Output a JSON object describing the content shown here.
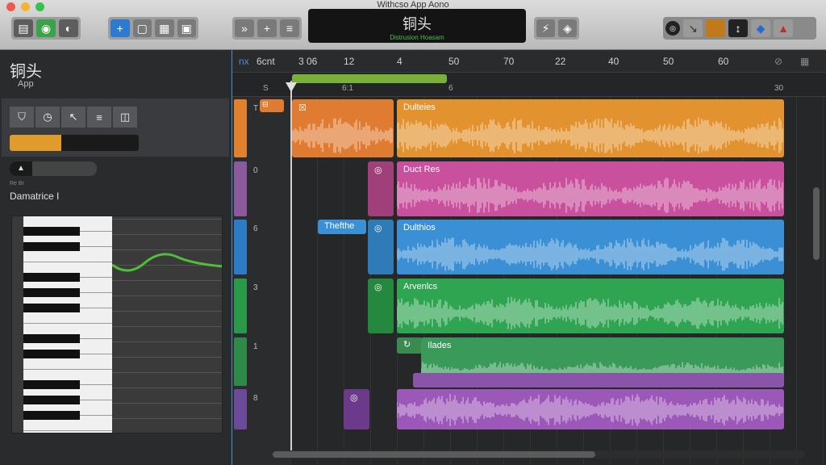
{
  "window": {
    "title": "Withcso App Aono"
  },
  "toolbar": {
    "left_icons": [
      "library-icon",
      "smart-controls-icon",
      "mixer-icon"
    ],
    "edit_icons": [
      "add-track-icon",
      "editor-icon",
      "loop-icon",
      "note-icon"
    ],
    "transport_icons": [
      "forward-icon",
      "plus-icon",
      "list-icon"
    ],
    "right_icons": [
      "tuner-icon",
      "metronome-icon"
    ],
    "lcd_title": "铜头",
    "lcd_sub": "Distrusion Hoasam"
  },
  "inspector": {
    "title": "铜头",
    "subtitle": "App",
    "tool_icons": [
      "shield-icon",
      "timer-icon",
      "pointer-icon",
      "menu-icon",
      "split-icon"
    ],
    "level": 0.4,
    "small_label": "Re  Br",
    "track_name": "Damatrice I"
  },
  "ruler": {
    "left_label": "nx",
    "count_label": "6cnt",
    "ticks": [
      "3 06",
      "12",
      "4",
      "50",
      "70",
      "22",
      "40",
      "50",
      "60"
    ],
    "sub_ticks": [
      "S",
      "6:1",
      "6",
      "30"
    ]
  },
  "tracks": [
    {
      "num": "T",
      "color": "#e0812d"
    },
    {
      "num": "0",
      "color": "#8b5a9c"
    },
    {
      "num": "6",
      "color": "#2d7bc4"
    },
    {
      "num": "3",
      "color": "#2a9a4a"
    },
    {
      "num": "1",
      "color": "#2f8a48"
    },
    {
      "num": "8",
      "color": "#6b4a9a"
    }
  ],
  "regions": {
    "r1a_label": "Dulteies",
    "r1_color": "#e07b32",
    "r2_label": "Duct Res",
    "r2_color": "#c9509c",
    "r3a_label": "Thefthe",
    "r3b_label": "Dulthios",
    "r3_color": "#3b8fd4",
    "r4_label": "Arvenlcs",
    "r4_color": "#2fa552",
    "r5_label": "Ilades",
    "r5_color": "#3a9a5a",
    "r6_color": "#9c58b8"
  }
}
